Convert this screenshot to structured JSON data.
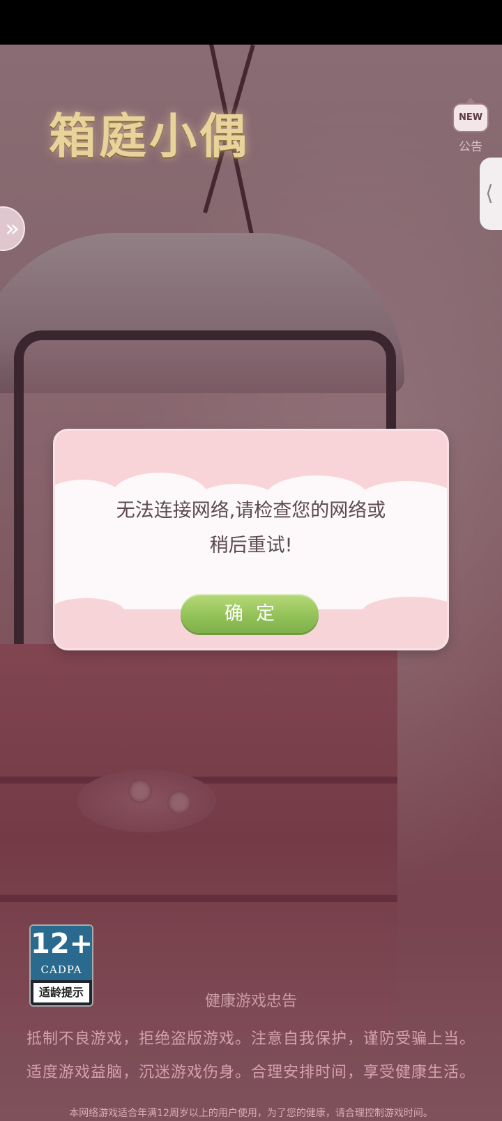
{
  "app": {
    "logo_text": "箱庭小偶"
  },
  "notice": {
    "icon_text": "NEW",
    "label": "公告"
  },
  "side_tab": {
    "icon": "chevron-left-icon",
    "glyph": "⟨"
  },
  "left_arrow": {
    "icon": "double-chevron-right-icon",
    "glyph": "»"
  },
  "dialog": {
    "message_line1": "无法连接网络,请检查您的网络或",
    "message_line2": "稍后重试!",
    "confirm_label": "确定"
  },
  "age_rating": {
    "number": "12+",
    "org": "CADPA",
    "label": "适龄提示"
  },
  "health": {
    "title": "健康游戏忠告",
    "line1": "抵制不良游戏，拒绝盗版游戏。注意自我保护，谨防受骗上当。",
    "line2": "适度游戏益脑，沉迷游戏伤身。合理安排时间，享受健康生活。",
    "note": "本网络游戏适合年满12周岁以上的用户使用，为了您的健康，请合理控制游戏时间。"
  },
  "colors": {
    "confirm_green": "#93c259",
    "dialog_pink": "#f8d3d7",
    "overlay": "#28101a"
  }
}
